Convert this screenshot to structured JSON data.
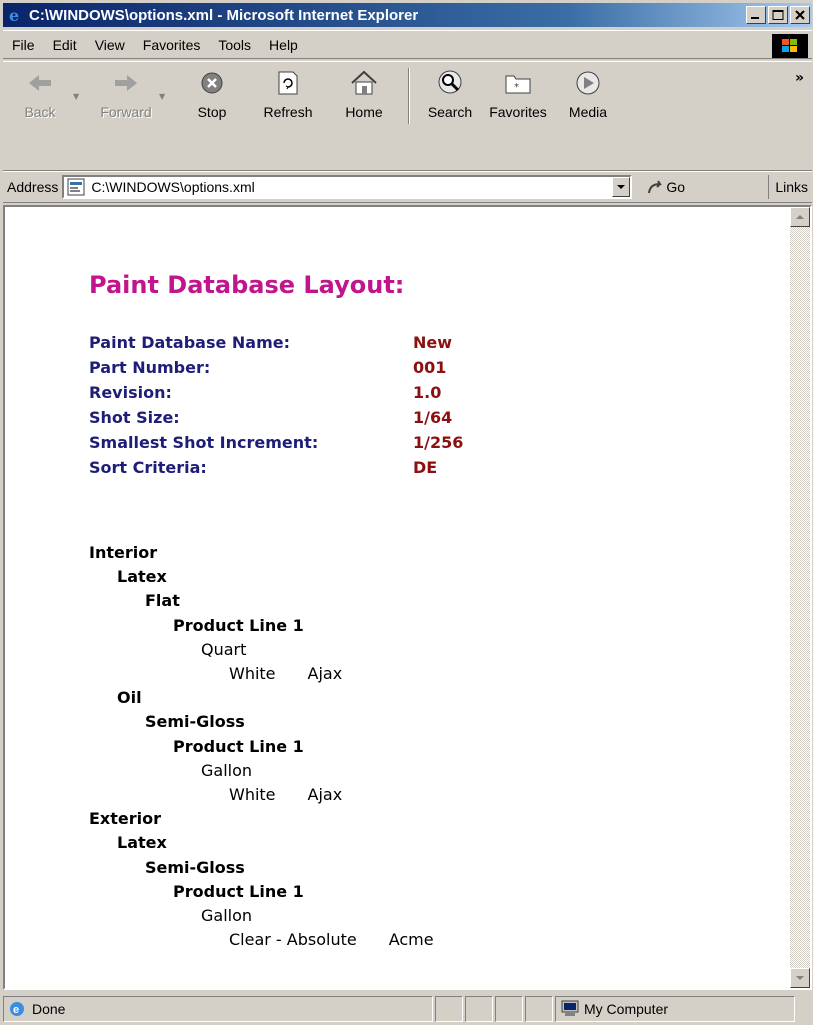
{
  "window": {
    "title": "C:\\WINDOWS\\options.xml - Microsoft Internet Explorer"
  },
  "menu": {
    "items": [
      "File",
      "Edit",
      "View",
      "Favorites",
      "Tools",
      "Help"
    ]
  },
  "toolbar": {
    "back": "Back",
    "forward": "Forward",
    "stop": "Stop",
    "refresh": "Refresh",
    "home": "Home",
    "search": "Search",
    "favorites": "Favorites",
    "media": "Media"
  },
  "address": {
    "label": "Address",
    "value": "C:\\WINDOWS\\options.xml",
    "go": "Go",
    "links": "Links"
  },
  "document": {
    "title": "Paint Database Layout:",
    "fields": [
      {
        "label": "Paint Database Name:",
        "value": "New"
      },
      {
        "label": "Part Number:",
        "value": "001"
      },
      {
        "label": "Revision:",
        "value": "1.0"
      },
      {
        "label": "Shot Size:",
        "value": "1/64"
      },
      {
        "label": "Smallest Shot Increment:",
        "value": "1/256"
      },
      {
        "label": "Sort Criteria:",
        "value": "DE"
      }
    ],
    "tree": [
      {
        "text": "Interior",
        "level": 0,
        "bold": true
      },
      {
        "text": "Latex",
        "level": 1,
        "bold": true
      },
      {
        "text": "Flat",
        "level": 2,
        "bold": true
      },
      {
        "text": "Product Line 1",
        "level": 3,
        "bold": true
      },
      {
        "text": "Quart",
        "level": 4,
        "bold": false
      },
      {
        "text": "White",
        "extra": "Ajax",
        "level": 5,
        "bold": false
      },
      {
        "text": "Oil",
        "level": 1,
        "bold": true
      },
      {
        "text": "Semi-Gloss",
        "level": 2,
        "bold": true
      },
      {
        "text": "Product Line 1",
        "level": 3,
        "bold": true
      },
      {
        "text": "Gallon",
        "level": 4,
        "bold": false
      },
      {
        "text": "White",
        "extra": "Ajax",
        "level": 5,
        "bold": false
      },
      {
        "text": "Exterior",
        "level": 0,
        "bold": true
      },
      {
        "text": "Latex",
        "level": 1,
        "bold": true
      },
      {
        "text": "Semi-Gloss",
        "level": 2,
        "bold": true
      },
      {
        "text": "Product Line 1",
        "level": 3,
        "bold": true
      },
      {
        "text": "Gallon",
        "level": 4,
        "bold": false
      },
      {
        "text": "Clear - Absolute",
        "extra": "Acme",
        "level": 5,
        "bold": false
      }
    ]
  },
  "status": {
    "text": "Done",
    "zone": "My Computer"
  },
  "colors": {
    "title": "#c0158c",
    "field_label": "#1e1e78",
    "field_value": "#8b1010"
  }
}
